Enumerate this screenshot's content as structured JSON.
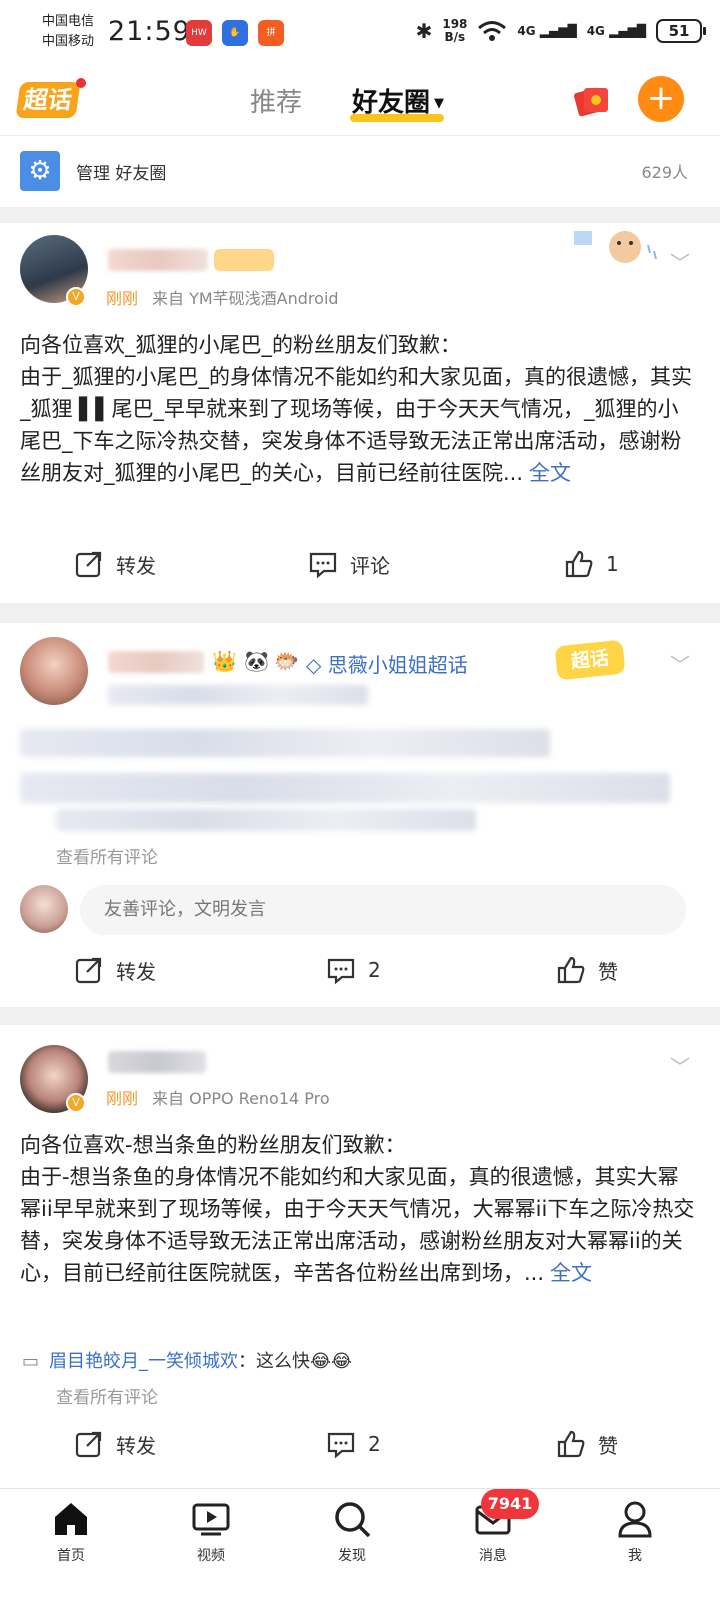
{
  "status_bar": {
    "carrier_1": "中国电信",
    "carrier_2": "中国移动",
    "time": "21:59",
    "net_speed_value": "198",
    "net_speed_unit": "B/s",
    "signal_1": "4G",
    "signal_2": "4G",
    "battery": "51"
  },
  "header": {
    "logo": "超话",
    "tab_recommend": "推荐",
    "tab_friends": "好友圈",
    "add_button": "+"
  },
  "manage_row": {
    "label": "管理 好友圈",
    "count": "629人"
  },
  "posts": [
    {
      "time": "刚刚",
      "source": "来自 YM芊砚浅酒Android",
      "text": "向各位喜欢_狐狸的小尾巴_的粉丝朋友们致歉：\n由于_狐狸的小尾巴_的身体情况不能如约和大家见面，真的很遗憾，其实_狐狸 ▌▌尾巴_早早就来到了现场等候，由于今天天气情况，_狐狸的小尾巴_下车之际冷热交替，突发身体不适导致无法正常出席活动，感谢粉丝朋友对_狐狸的小尾巴_的关心，目前已经前往医院...",
      "full_text": "全文",
      "repost": "转发",
      "comment": "评论",
      "like": "1"
    },
    {
      "topic": "思薇小姐姐超话",
      "super_tag": "超话",
      "view_all": "查看所有评论",
      "comment_placeholder": "友善评论，文明发言",
      "repost": "转发",
      "comment": "2",
      "like": "赞"
    },
    {
      "time": "刚刚",
      "source": "来自 OPPO Reno14 Pro",
      "text": "向各位喜欢-想当条鱼的粉丝朋友们致歉：\n由于-想当条鱼的身体情况不能如约和大家见面，真的很遗憾，其实大幂幂ii早早就来到了现场等候，由于今天天气情况，大幂幂ii下车之际冷热交替，突发身体不适导致无法正常出席活动，感谢粉丝朋友对大幂幂ii的关心，目前已经前往医院就医，辛苦各位粉丝出席到场，...",
      "full_text": "全文",
      "comment_name": "眉目艳皎月_一笑倾城欢",
      "comment_text": "：这么快😂😂",
      "view_all": "查看所有评论",
      "repost": "转发",
      "comment": "2",
      "like": "赞"
    }
  ],
  "bottom_nav": {
    "home": "首页",
    "video": "视频",
    "discover": "发现",
    "messages": "消息",
    "messages_badge": "7941",
    "me": "我"
  },
  "colors": {
    "accent": "#ff8b12",
    "link": "#3b70c8",
    "badge": "#f0353b",
    "tab_underline": "#f9c51a"
  }
}
